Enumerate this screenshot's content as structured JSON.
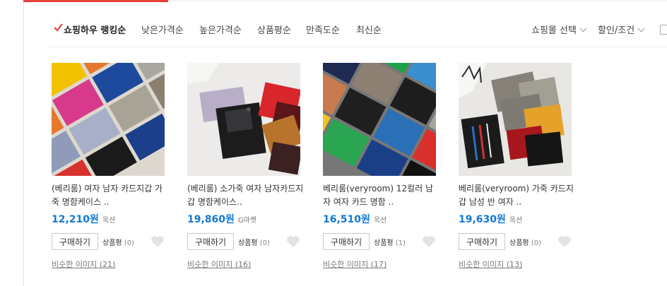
{
  "sort": {
    "items": [
      "쇼핑하우 랭킹순",
      "낮은가격순",
      "높은가격순",
      "상품평순",
      "만족도순",
      "최신순"
    ],
    "mall_select": "쇼핑몰 선택",
    "discount": "할인/조건"
  },
  "products": [
    {
      "title": "(베리룸) 여자 남자 카드지갑 가죽 명함케이스 ..",
      "price": "12,210원",
      "mall": "옥션",
      "buy": "구매하기",
      "review_label": "상품평",
      "review_count": "(0)",
      "similar": "비슷한 이미지 (21)"
    },
    {
      "title": "(베리룸) 소가죽 여자 남자카드지갑 명함케이스..",
      "price": "19,860원",
      "mall": "G마켓",
      "buy": "구매하기",
      "review_label": "상품평",
      "review_count": "(0)",
      "similar": "비슷한 이미지 (16)"
    },
    {
      "title": "베리룸(veryroom) 12컬러 남자 여자 카드 명함 ..",
      "price": "16,510원",
      "mall": "옥션",
      "buy": "구매하기",
      "review_label": "상품평",
      "review_count": "(1)",
      "similar": "비슷한 이미지 (17)"
    },
    {
      "title": "베리룸(veryroom) 가죽 카드지갑 남성 반 여자 ..",
      "price": "19,630원",
      "mall": "옥션",
      "buy": "구매하기",
      "review_label": "상품평",
      "review_count": "(0)",
      "similar": "비슷한 이미지 (13)"
    }
  ],
  "colors": {
    "accent": "#e8403a",
    "price": "#1178d6"
  },
  "icons": [
    "check-icon",
    "chevron-down-icon",
    "heart-icon"
  ]
}
